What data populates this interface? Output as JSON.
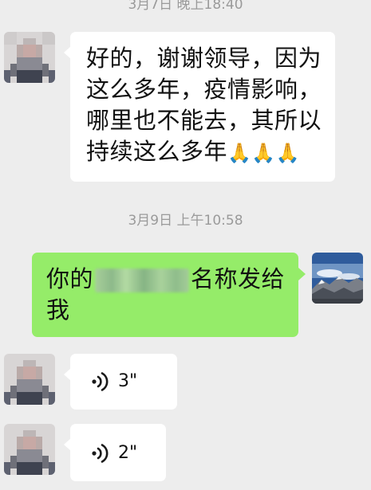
{
  "timestamps": {
    "top": "3月7日 晚上18:40",
    "middle": "3月9日 上午10:58"
  },
  "messages": {
    "incoming_text": {
      "lines": [
        "好的，谢谢领导，因为",
        "这么多年，疫情影响，",
        "哪里也不能去，其所以",
        "持续这么多年"
      ],
      "emoji": "🙏🙏🙏"
    },
    "outgoing_text": {
      "line1_before": "你的",
      "line1_after": "名称发给",
      "line2": "我"
    },
    "voice_1": {
      "duration": "3\""
    },
    "voice_2": {
      "duration": "2\""
    }
  },
  "colors": {
    "background": "#ededed",
    "incoming_bubble": "#ffffff",
    "outgoing_bubble": "#95ec69",
    "timestamp_text": "#9a9a9a"
  },
  "icons": {
    "voice": "voice-wave-icon",
    "contact_avatar": "pixelated-avatar",
    "own_avatar": "mountain-landscape-avatar"
  }
}
